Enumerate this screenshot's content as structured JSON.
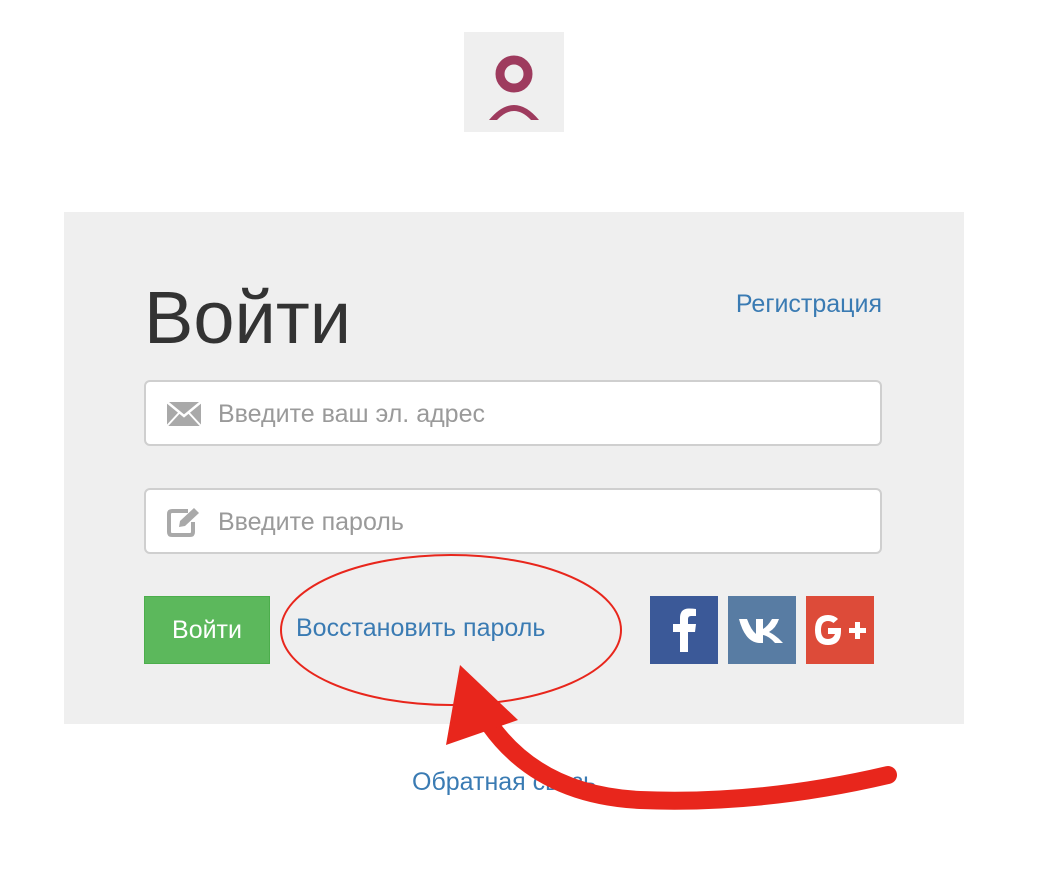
{
  "logo": {
    "icon": "user-avatar-logo-icon",
    "color": "#9e3b5e"
  },
  "login_form": {
    "title": "Войти",
    "register_link": "Регистрация",
    "email": {
      "placeholder": "Введите ваш эл. адрес",
      "value": "",
      "icon": "envelope-icon"
    },
    "password": {
      "placeholder": "Введите пароль",
      "value": "",
      "icon": "edit-pencil-icon"
    },
    "submit_label": "Войти",
    "recover_link": "Восстановить пароль",
    "social": {
      "facebook": {
        "icon": "facebook-icon",
        "color": "#3b5998"
      },
      "vk": {
        "icon": "vk-icon",
        "color": "#587ca3"
      },
      "google": {
        "icon": "google-plus-icon",
        "color": "#dd4b39"
      }
    }
  },
  "footer": {
    "feedback_link": "Обратная связь"
  },
  "annotation": {
    "color": "#e8261c",
    "target": "recover_link"
  }
}
